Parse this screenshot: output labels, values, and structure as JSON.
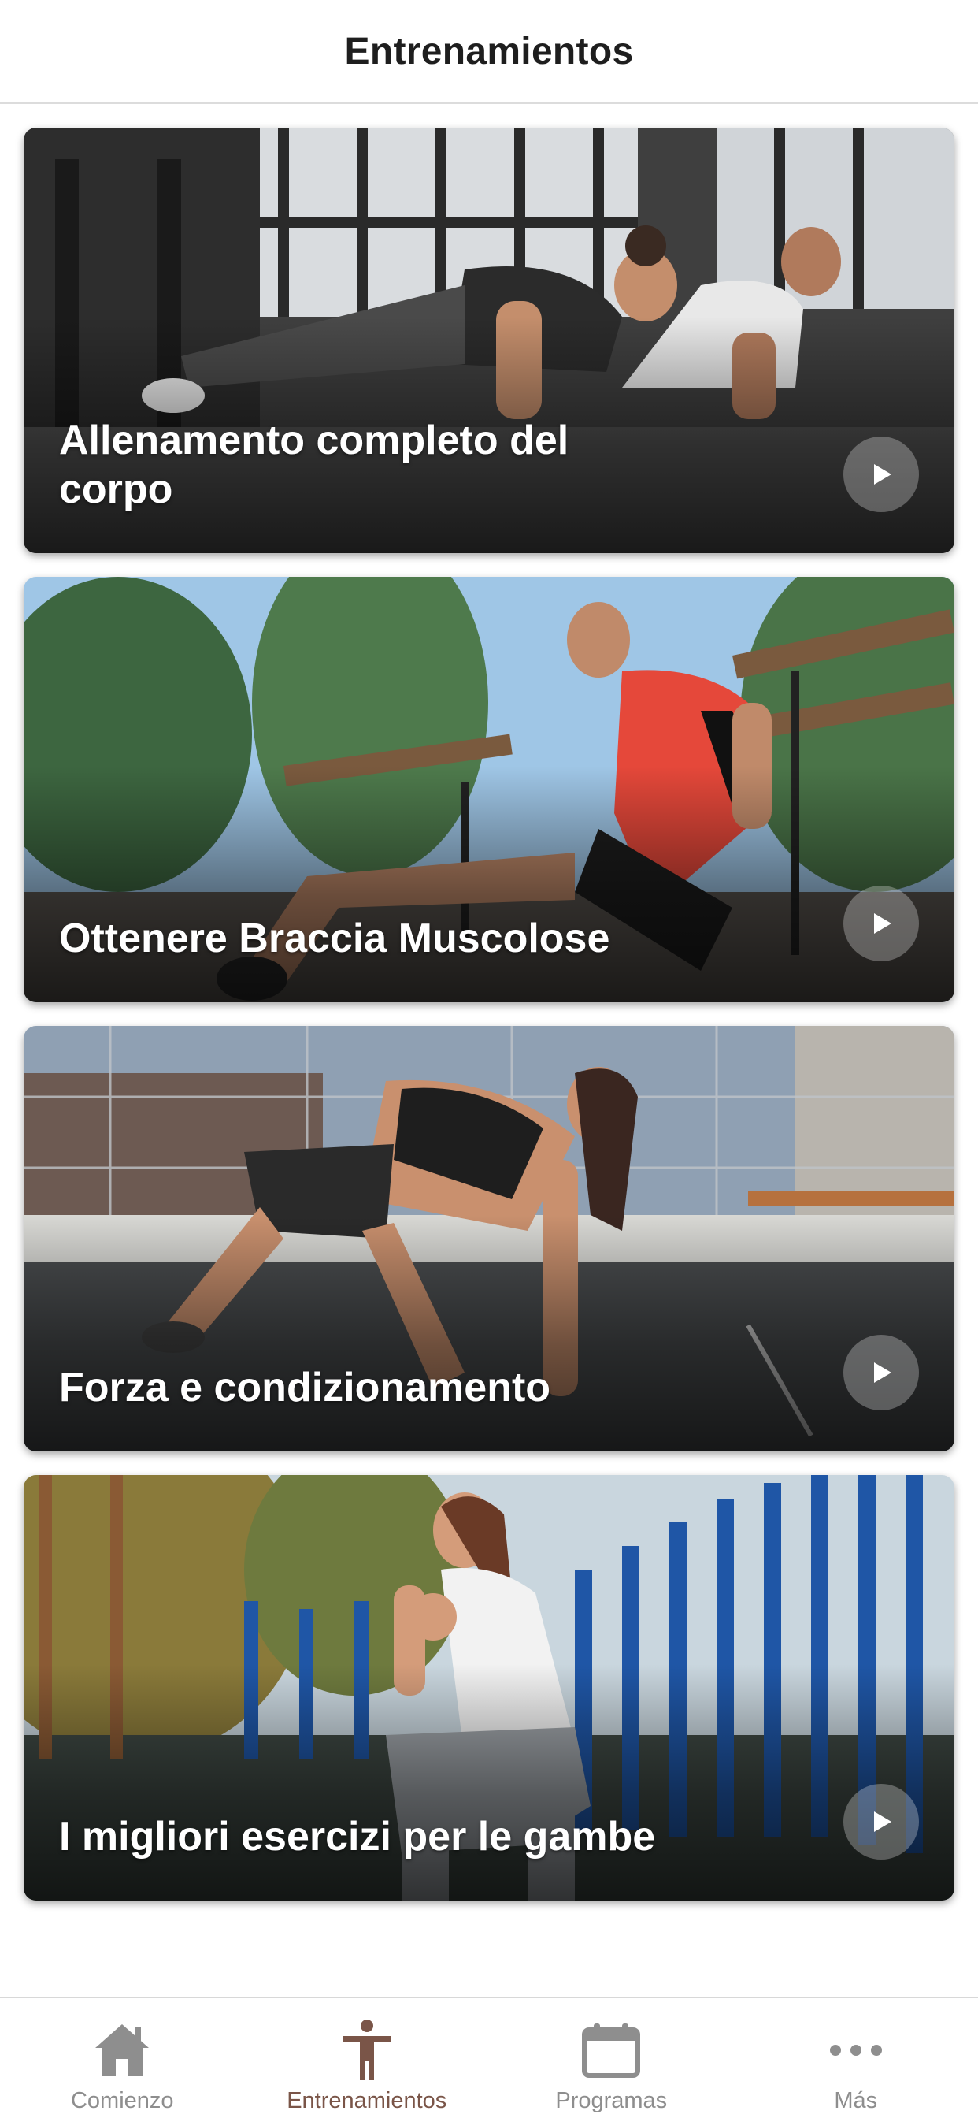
{
  "header": {
    "title": "Entrenamientos"
  },
  "workouts": [
    {
      "title": "Allenamento completo del corpo"
    },
    {
      "title": "Ottenere Braccia Muscolose"
    },
    {
      "title": "Forza e condizionamento"
    },
    {
      "title": "I migliori esercizi per le gambe"
    }
  ],
  "tabs": [
    {
      "label": "Comienzo",
      "icon": "home-icon"
    },
    {
      "label": "Entrenamientos",
      "icon": "person-icon",
      "active": true
    },
    {
      "label": "Programas",
      "icon": "calendar-icon"
    },
    {
      "label": "Más",
      "icon": "more-icon"
    }
  ],
  "colors": {
    "active_tab": "#7a5548",
    "inactive_tab": "#8e8e8e"
  }
}
